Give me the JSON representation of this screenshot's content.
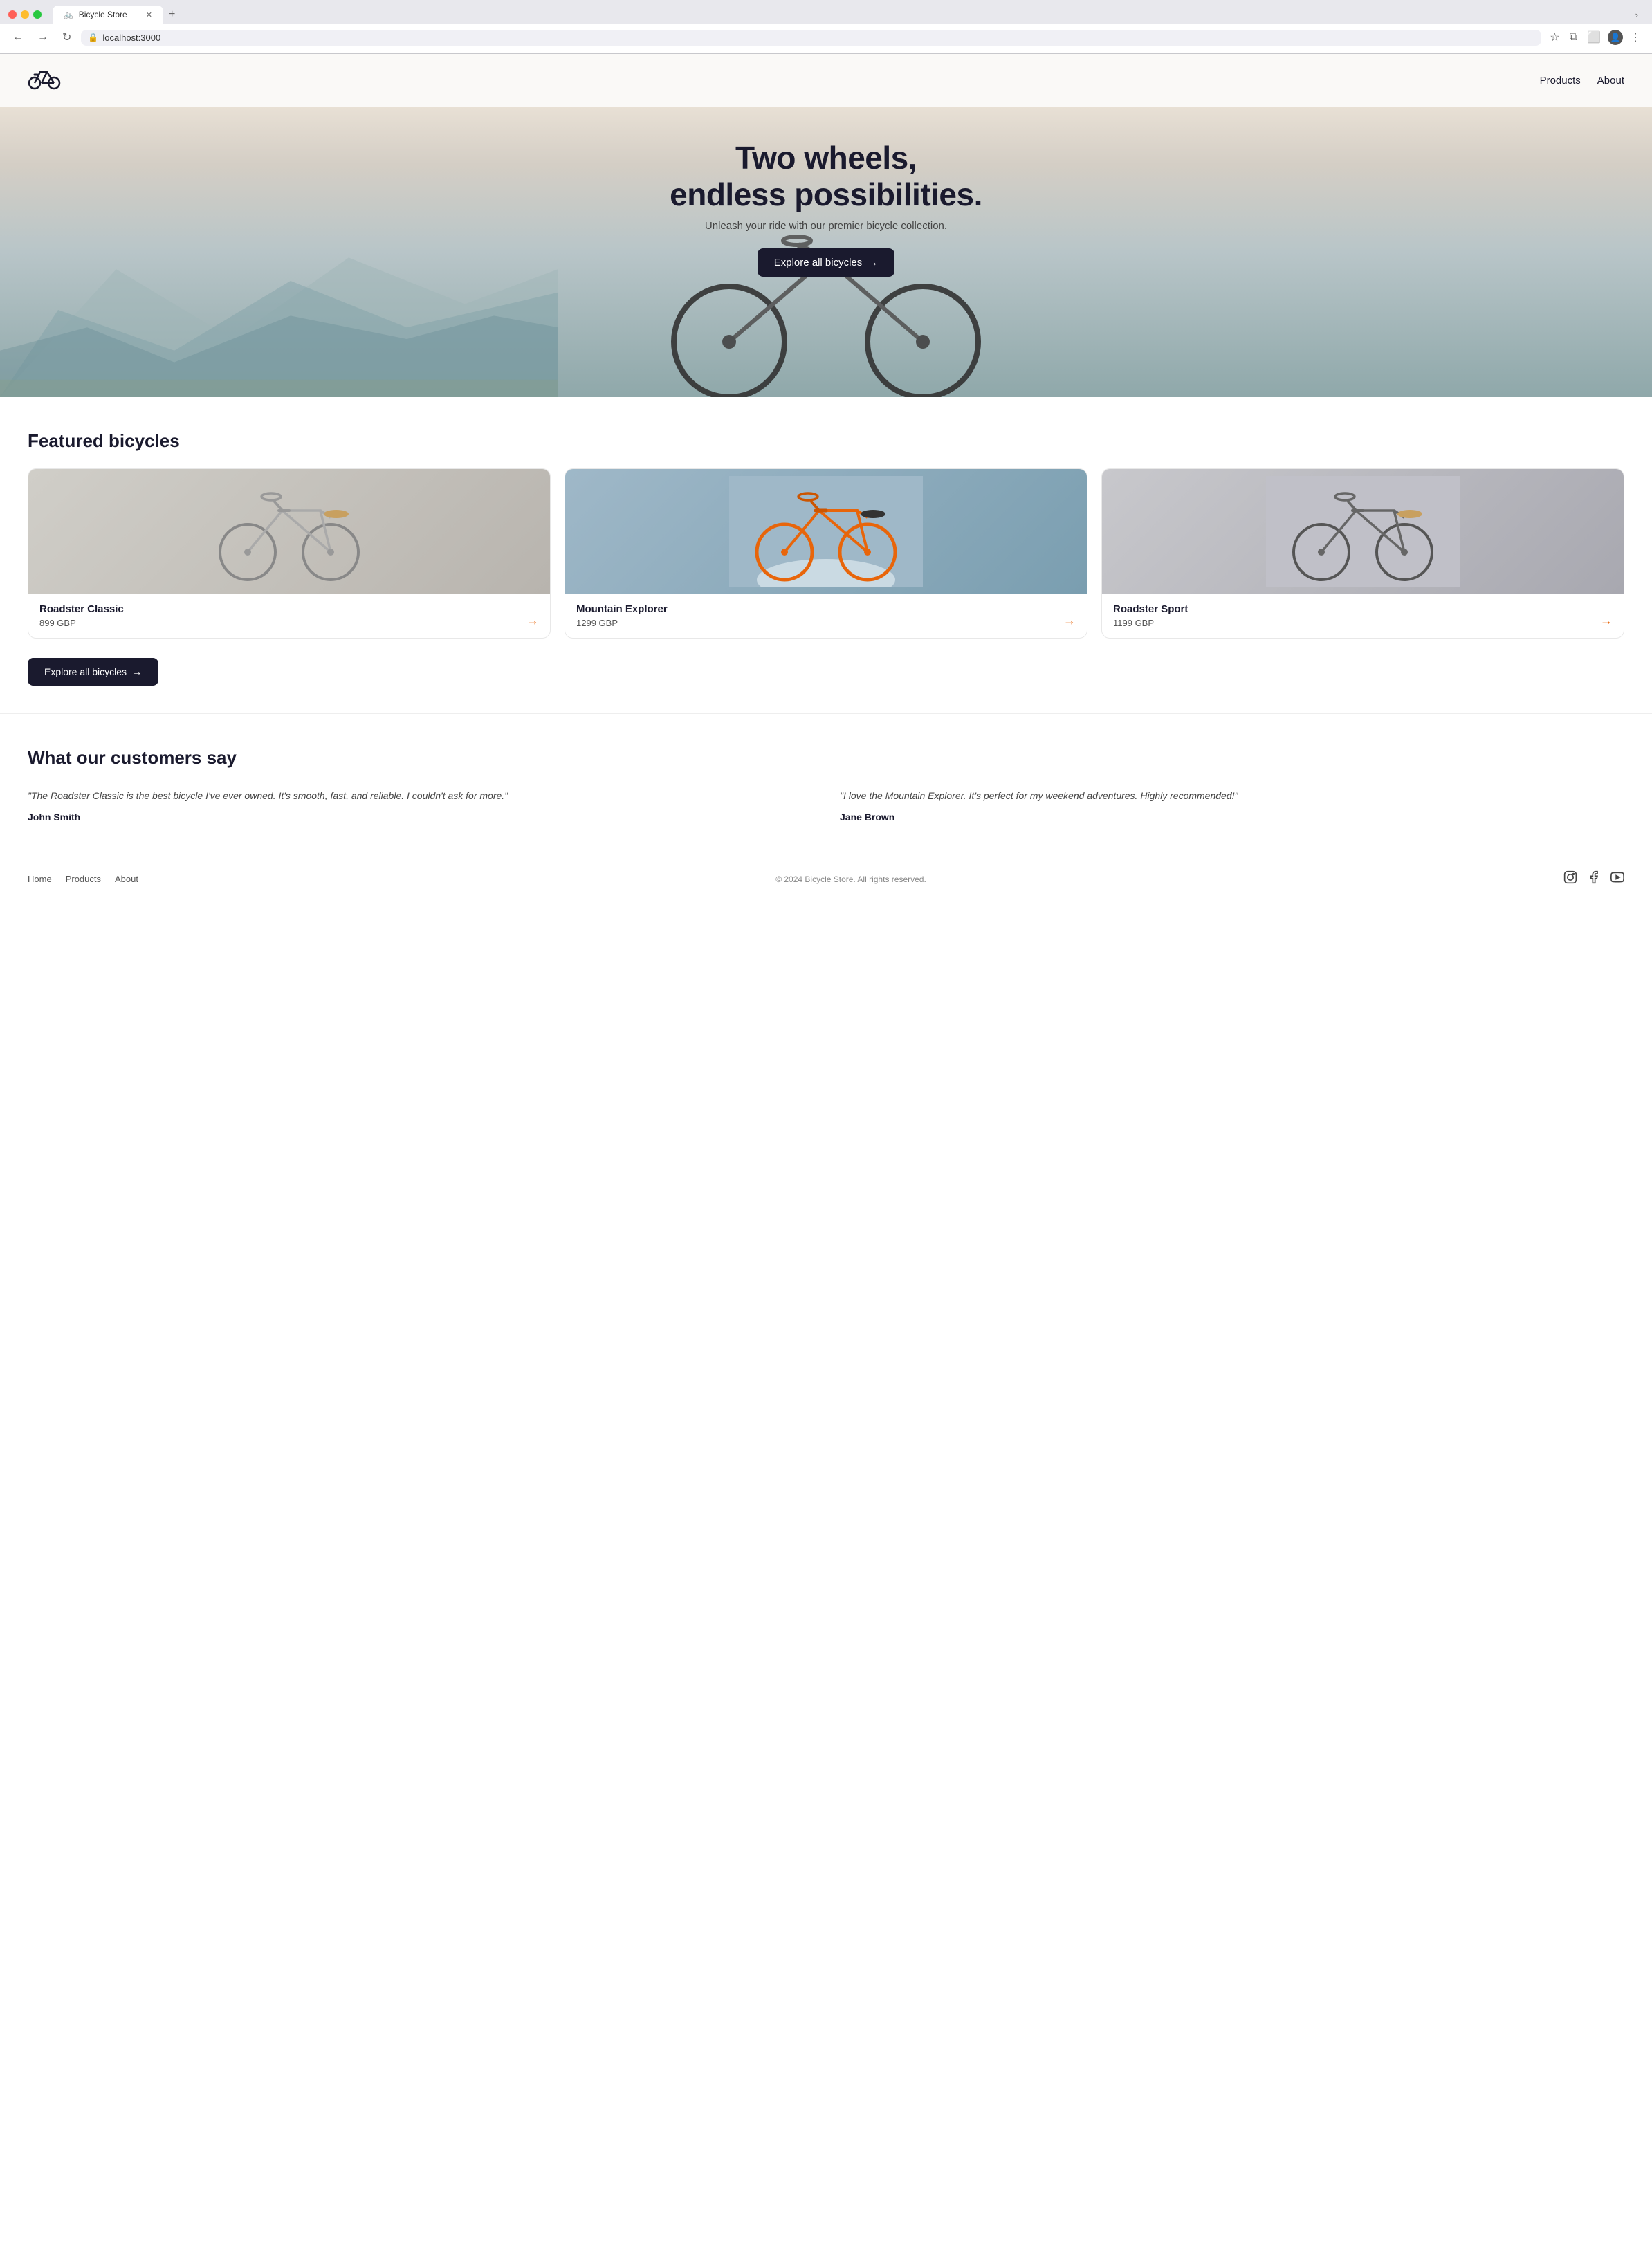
{
  "browser": {
    "tab_title": "Bicycle Store",
    "tab_favicon": "🚲",
    "close_icon": "✕",
    "new_tab_icon": "+",
    "back_icon": "←",
    "forward_icon": "→",
    "refresh_icon": "↻",
    "url": "localhost:3000",
    "lock_icon": "🔒",
    "bookmark_icon": "☆",
    "extensions_icon": "⧉",
    "sidebar_icon": "⬜",
    "profile_icon": "👤",
    "menu_icon": "⋮",
    "chevron_icon": "›"
  },
  "site": {
    "logo_icon": "🚲",
    "title": "Bicycle Store",
    "nav": {
      "products": "Products",
      "about": "About"
    },
    "hero": {
      "title_line1": "Two wheels,",
      "title_line2": "endless possibilities.",
      "subtitle": "Unleash your ride with our premier bicycle collection.",
      "cta_label": "Explore all bicycles",
      "cta_arrow": "→"
    },
    "featured": {
      "section_title": "Featured bicycles",
      "products": [
        {
          "name": "Roadster Classic",
          "price": "899 GBP",
          "arrow": "→",
          "image_type": "light"
        },
        {
          "name": "Mountain Explorer",
          "price": "1299 GBP",
          "arrow": "→",
          "image_type": "snow"
        },
        {
          "name": "Roadster Sport",
          "price": "1199 GBP",
          "arrow": "→",
          "image_type": "grey"
        }
      ],
      "explore_btn_label": "Explore all bicycles",
      "explore_btn_arrow": "→"
    },
    "testimonials": {
      "section_title": "What our customers say",
      "items": [
        {
          "text": "\"The Roadster Classic is the best bicycle I've ever owned. It's smooth, fast, and reliable. I couldn't ask for more.\"",
          "author": "John Smith"
        },
        {
          "text": "\"I love the Mountain Explorer. It's perfect for my weekend adventures. Highly recommended!\"",
          "author": "Jane Brown"
        }
      ]
    },
    "footer": {
      "links": [
        "Home",
        "Products",
        "About"
      ],
      "copyright": "© 2024 Bicycle Store. All rights reserved.",
      "social_instagram": "📷",
      "social_facebook": "f",
      "social_youtube": "▶"
    }
  }
}
